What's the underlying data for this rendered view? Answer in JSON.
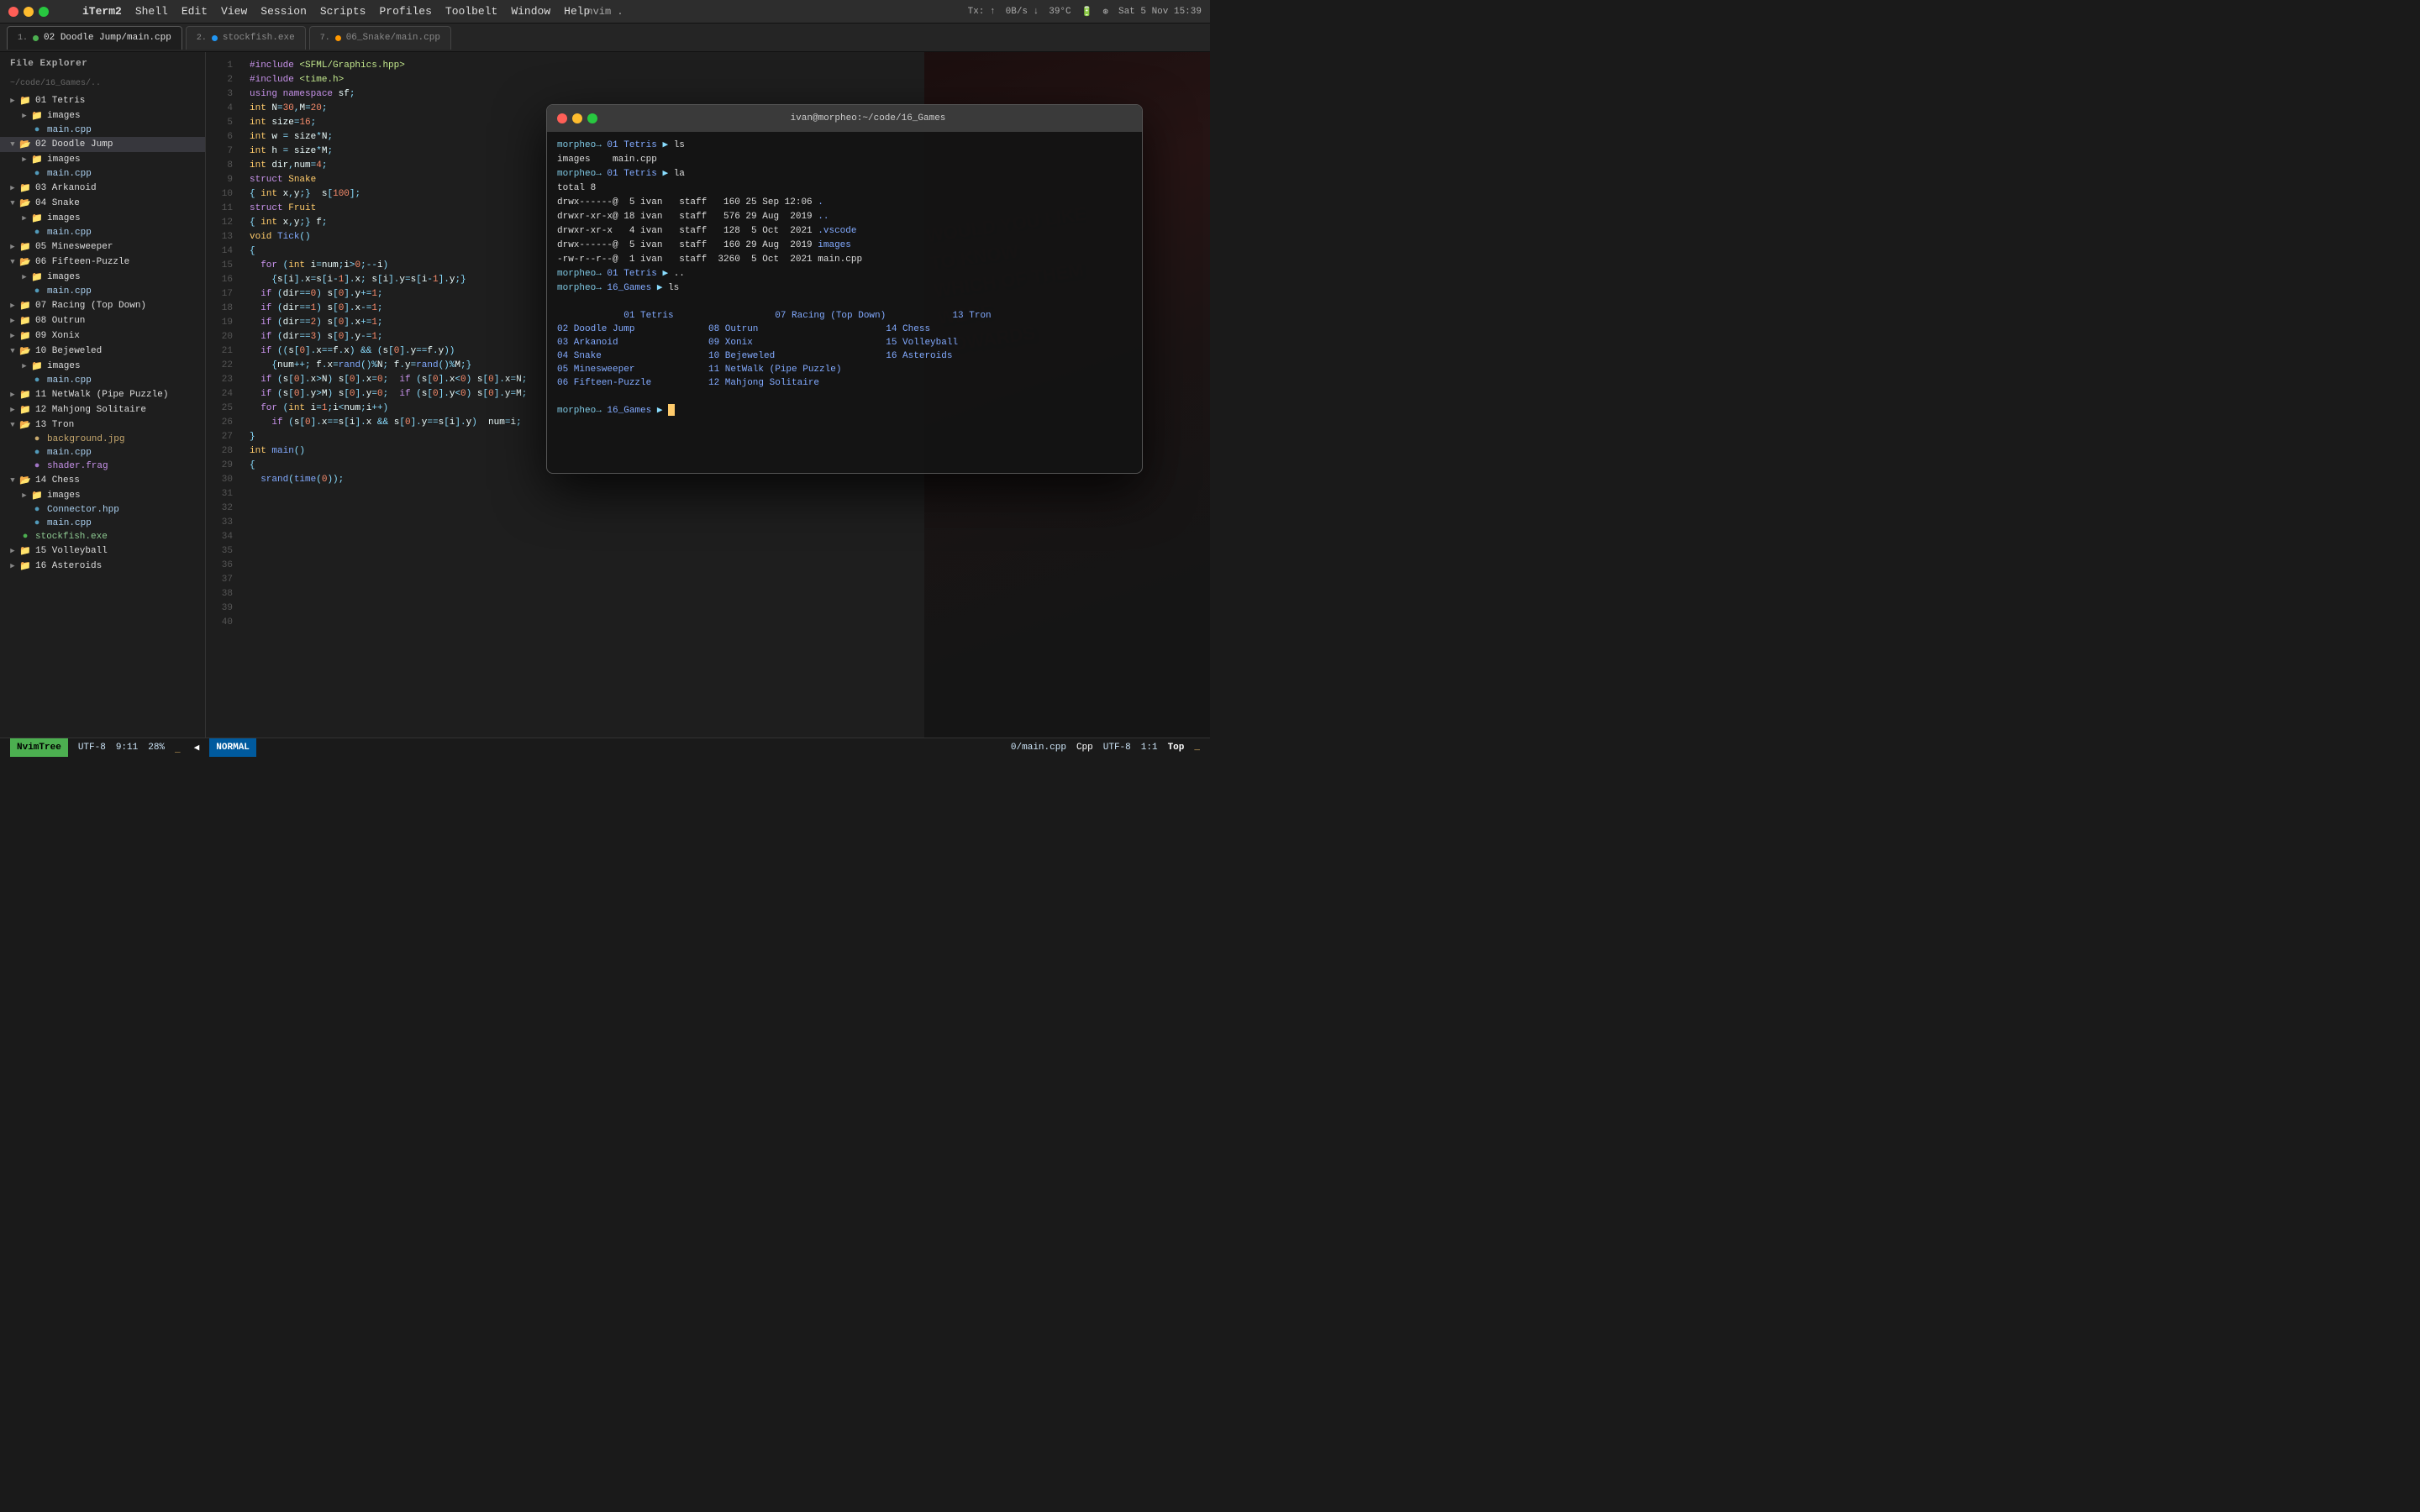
{
  "titlebar": {
    "title": "nvim .",
    "menu_items": [
      "iTerm2",
      "Shell",
      "Edit",
      "View",
      "Session",
      "Scripts",
      "Profiles",
      "Toolbelt",
      "Window",
      "Help"
    ],
    "status": {
      "tx": "Tx:",
      "rx": "0B/s",
      "temp": "39°C",
      "time": "Sat 5 Nov  15:39"
    }
  },
  "tabs": [
    {
      "id": 1,
      "label": "02 Doodle Jump/main.cpp",
      "active": true,
      "dot_color": "green",
      "num": "1."
    },
    {
      "id": 2,
      "label": "stockfish.exe",
      "active": false,
      "dot_color": "blue",
      "num": "2."
    },
    {
      "id": 3,
      "label": "06_Snake/main.cpp",
      "active": false,
      "dot_color": "orange",
      "num": "7."
    }
  ],
  "sidebar": {
    "title": "File Explorer",
    "path": "~/code/16_Games/..",
    "items": [
      {
        "indent": 0,
        "type": "folder",
        "open": true,
        "label": "01 Tetris"
      },
      {
        "indent": 1,
        "type": "folder",
        "open": false,
        "label": "images"
      },
      {
        "indent": 1,
        "type": "file",
        "ext": "cpp",
        "label": "main.cpp"
      },
      {
        "indent": 0,
        "type": "folder",
        "open": true,
        "label": "02 Doodle Jump",
        "selected": true
      },
      {
        "indent": 1,
        "type": "folder",
        "open": false,
        "label": "images"
      },
      {
        "indent": 1,
        "type": "file",
        "ext": "cpp",
        "label": "main.cpp"
      },
      {
        "indent": 0,
        "type": "folder",
        "open": true,
        "label": "03 Arkanoid"
      },
      {
        "indent": 0,
        "type": "folder",
        "open": true,
        "label": "04 Snake"
      },
      {
        "indent": 1,
        "type": "folder",
        "open": false,
        "label": "images"
      },
      {
        "indent": 1,
        "type": "file",
        "ext": "cpp",
        "label": "main.cpp"
      },
      {
        "indent": 0,
        "type": "folder",
        "open": true,
        "label": "05 Minesweeper"
      },
      {
        "indent": 0,
        "type": "folder",
        "open": true,
        "label": "06 Fifteen-Puzzle"
      },
      {
        "indent": 1,
        "type": "folder",
        "open": false,
        "label": "images"
      },
      {
        "indent": 1,
        "type": "file",
        "ext": "cpp",
        "label": "main.cpp"
      },
      {
        "indent": 0,
        "type": "folder",
        "open": false,
        "label": "07 Racing (Top Down)"
      },
      {
        "indent": 0,
        "type": "folder",
        "open": false,
        "label": "08 Outrun"
      },
      {
        "indent": 0,
        "type": "folder",
        "open": false,
        "label": "09 Xonix"
      },
      {
        "indent": 0,
        "type": "folder",
        "open": true,
        "label": "10 Bejeweled"
      },
      {
        "indent": 1,
        "type": "folder",
        "open": false,
        "label": "images"
      },
      {
        "indent": 1,
        "type": "file",
        "ext": "cpp",
        "label": "main.cpp"
      },
      {
        "indent": 0,
        "type": "folder",
        "open": false,
        "label": "11 NetWalk (Pipe Puzzle)"
      },
      {
        "indent": 0,
        "type": "folder",
        "open": false,
        "label": "12 Mahjong Solitaire"
      },
      {
        "indent": 0,
        "type": "folder",
        "open": true,
        "label": "13 Tron"
      },
      {
        "indent": 1,
        "type": "file",
        "ext": "jpg",
        "label": "background.jpg"
      },
      {
        "indent": 1,
        "type": "file",
        "ext": "cpp",
        "label": "main.cpp"
      },
      {
        "indent": 1,
        "type": "file",
        "ext": "frag",
        "label": "shader.frag"
      },
      {
        "indent": 0,
        "type": "folder",
        "open": true,
        "label": "14 Chess"
      },
      {
        "indent": 1,
        "type": "folder",
        "open": false,
        "label": "images"
      },
      {
        "indent": 1,
        "type": "file",
        "ext": "hpp",
        "label": "Connector.hpp"
      },
      {
        "indent": 1,
        "type": "file",
        "ext": "cpp",
        "label": "main.cpp"
      },
      {
        "indent": 0,
        "type": "file",
        "ext": "exe",
        "label": "stockfish.exe"
      },
      {
        "indent": 0,
        "type": "folder",
        "open": false,
        "label": "15 Volleyball"
      },
      {
        "indent": 0,
        "type": "folder",
        "open": false,
        "label": "16 Asteroids"
      }
    ]
  },
  "editor": {
    "lines": [
      {
        "n": 1,
        "code": "#include <SFML/Graphics.hpp>",
        "highlight": true
      },
      {
        "n": 2,
        "code": "#include <time.h>"
      },
      {
        "n": 3,
        "code": "using namespace sf;"
      },
      {
        "n": 4,
        "code": ""
      },
      {
        "n": 5,
        "code": "int N=30,M=20;"
      },
      {
        "n": 6,
        "code": "int size=16;"
      },
      {
        "n": 7,
        "code": "int w = size*N;"
      },
      {
        "n": 8,
        "code": "int h = size*M;"
      },
      {
        "n": 9,
        "code": ""
      },
      {
        "n": 10,
        "code": "int dir,num=4;"
      },
      {
        "n": 11,
        "code": ""
      },
      {
        "n": 12,
        "code": "struct Snake"
      },
      {
        "n": 13,
        "code": "{ int x,y;}  s[100];"
      },
      {
        "n": 14,
        "code": ""
      },
      {
        "n": 15,
        "code": "struct Fruit"
      },
      {
        "n": 16,
        "code": "{ int x,y;} f;"
      },
      {
        "n": 17,
        "code": ""
      },
      {
        "n": 18,
        "code": "void Tick()"
      },
      {
        "n": 19,
        "code": "{"
      },
      {
        "n": 20,
        "code": "  for (int i=num;i>0;--i)"
      },
      {
        "n": 21,
        "code": "    {s[i].x=s[i-1].x; s[i].y=s[i-1].y;}"
      },
      {
        "n": 22,
        "code": ""
      },
      {
        "n": 23,
        "code": "  if (dir==0) s[0].y+=1;"
      },
      {
        "n": 24,
        "code": "  if (dir==1) s[0].x-=1;"
      },
      {
        "n": 25,
        "code": "  if (dir==2) s[0].x+=1;"
      },
      {
        "n": 26,
        "code": "  if (dir==3) s[0].y-=1;"
      },
      {
        "n": 27,
        "code": ""
      },
      {
        "n": 28,
        "code": "  if ((s[0].x==f.x) && (s[0].y==f.y))"
      },
      {
        "n": 29,
        "code": "    {num++; f.x=rand()%N; f.y=rand()%M;}"
      },
      {
        "n": 30,
        "code": ""
      },
      {
        "n": 31,
        "code": "  if (s[0].x>N) s[0].x=0;  if (s[0].x<0) s[0].x=N;"
      },
      {
        "n": 32,
        "code": "  if (s[0].y>M) s[0].y=0;  if (s[0].y<0) s[0].y=M;"
      },
      {
        "n": 33,
        "code": ""
      },
      {
        "n": 34,
        "code": "  for (int i=1;i<num;i++)"
      },
      {
        "n": 35,
        "code": "    if (s[0].x==s[i].x && s[0].y==s[i].y)  num=i;"
      },
      {
        "n": 36,
        "code": "}"
      },
      {
        "n": 37,
        "code": ""
      },
      {
        "n": 38,
        "code": "int main()"
      },
      {
        "n": 39,
        "code": "{"
      },
      {
        "n": 40,
        "code": "  srand(time(0));"
      }
    ]
  },
  "terminal": {
    "title": "ivan@morpheo:~/code/16_Games",
    "lines": [
      {
        "type": "prompt",
        "path": "01 Tetris",
        "cmd": "ls"
      },
      {
        "type": "output",
        "text": "images    main.cpp"
      },
      {
        "type": "prompt",
        "path": "01 Tetris",
        "cmd": "la"
      },
      {
        "type": "output",
        "text": "total 8"
      },
      {
        "type": "output",
        "text": "drwx------@  5 ivan   staff   160 25 Sep 12:06 ."
      },
      {
        "type": "output",
        "text": "drwxr-xr-x@ 18 ivan   staff   576 29 Aug  2019 .."
      },
      {
        "type": "output",
        "text": "drwxr-xr-x   4 ivan   staff   128  5 Oct  2021 .vscode"
      },
      {
        "type": "output",
        "text": "drwx------@  5 ivan   staff   160 29 Aug  2019 images"
      },
      {
        "type": "output",
        "text": "-rw-r--r--@  1 ivan   staff  3260  5 Oct  2021 main.cpp"
      },
      {
        "type": "prompt",
        "path": "01 Tetris",
        "cmd": ".."
      },
      {
        "type": "prompt",
        "path": "16_Games",
        "cmd": "ls"
      },
      {
        "type": "ls_grid",
        "cols": [
          [
            "01 Tetris",
            "02 Doodle Jump",
            "03 Arkanoid",
            "04 Snake",
            "05 Minesweeper",
            "06 Fifteen-Puzzle"
          ],
          [
            "07 Racing (Top Down)",
            "08 Outrun",
            "09 Xonix",
            "10 Bejeweled",
            "11 NetWalk (Pipe Puzzle)",
            "12 Mahjong Solitaire"
          ],
          [
            "13 Tron",
            "14 Chess",
            "15 Volleyball",
            "16 Asteroids"
          ]
        ]
      },
      {
        "type": "prompt_cursor",
        "path": "16_Games",
        "cmd": ""
      }
    ]
  },
  "statusbar": {
    "left": [
      {
        "id": "nvimtree",
        "text": "NvimTree"
      },
      {
        "id": "encoding",
        "text": "UTF-8"
      },
      {
        "id": "position",
        "text": "9:11"
      },
      {
        "id": "percent",
        "text": "28%"
      },
      {
        "id": "cursor_indicator",
        "text": "_"
      },
      {
        "id": "mode",
        "text": "NORMAL"
      }
    ],
    "right": [
      {
        "id": "filename",
        "text": "0/main.cpp"
      },
      {
        "id": "filetype",
        "text": "Cpp"
      },
      {
        "id": "enc2",
        "text": "UTF-8"
      },
      {
        "id": "pos2",
        "text": "1:1"
      },
      {
        "id": "scroll",
        "text": "Top"
      }
    ]
  }
}
